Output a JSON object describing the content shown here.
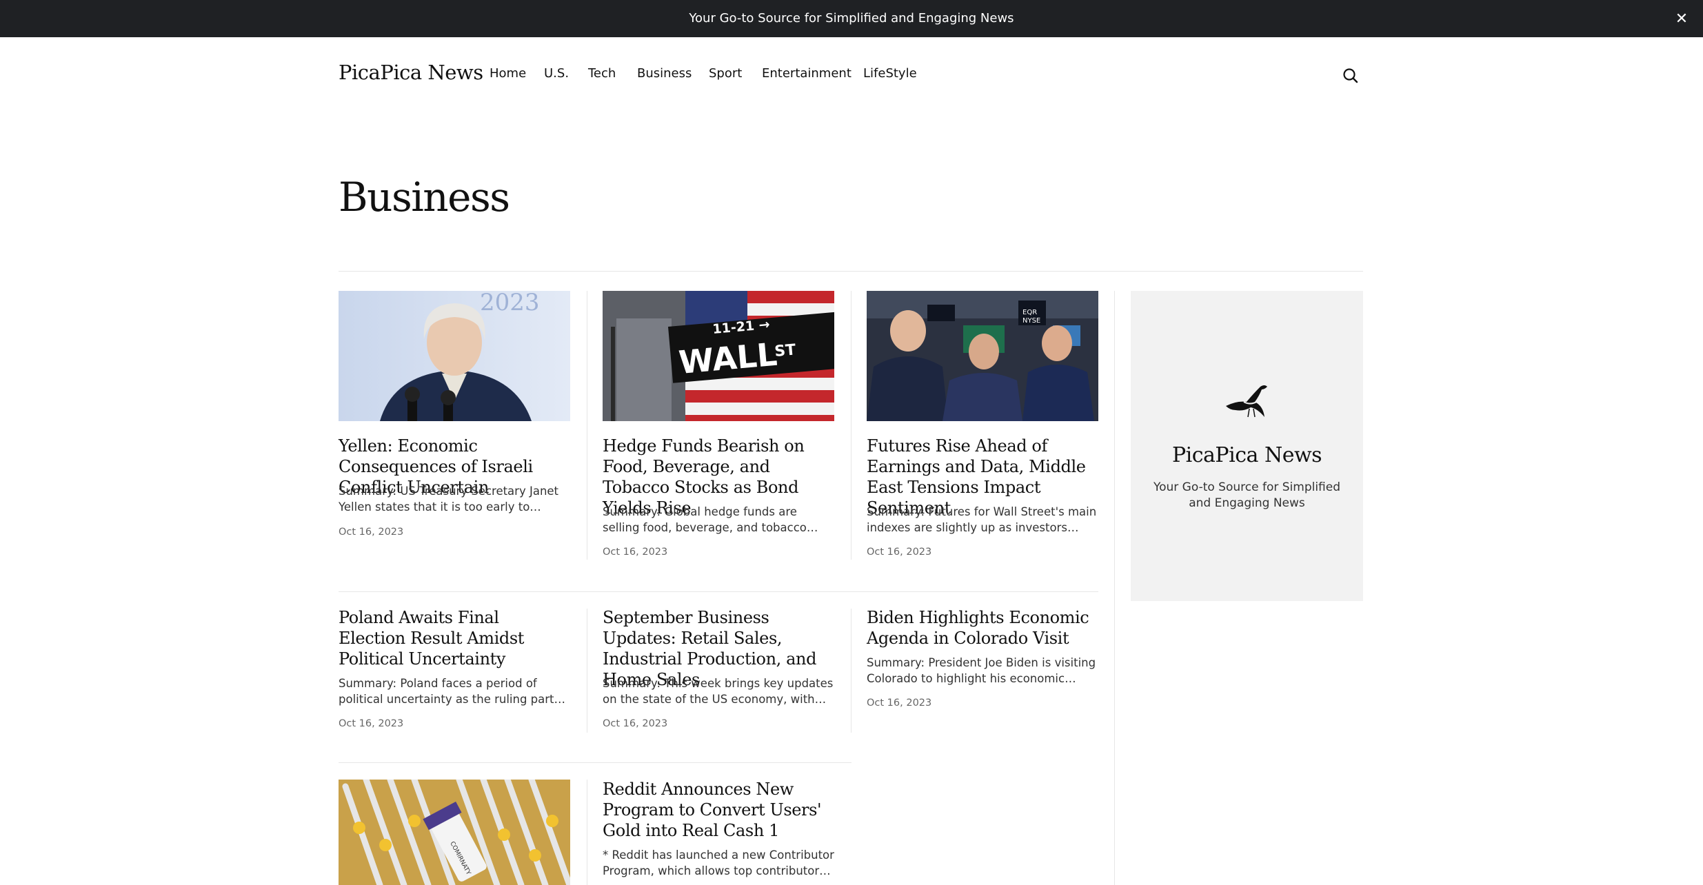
{
  "banner": {
    "text": "Your Go-to Source for Simplified and Engaging News",
    "close_icon": "close-icon"
  },
  "header": {
    "logo": "PicaPica News",
    "nav": [
      "Home",
      "U.S.",
      "Tech",
      "Business",
      "Sport",
      "Entertainment",
      "LifeStyle"
    ],
    "search_icon": "search-icon"
  },
  "page": {
    "title": "Business"
  },
  "articles": [
    {
      "title": "Yellen: Economic Consequences of Israeli Conflict Uncertain",
      "summary": "Summary: US Treasury Secretary Janet Yellen states that it is too early to predict the economic consequences of the Israeli conflict.",
      "date": "Oct 16, 2023",
      "image": "photo-yellen-speaking"
    },
    {
      "title": "Hedge Funds Bearish on Food, Beverage, and Tobacco Stocks as Bond Yields Rise",
      "summary": "Summary: Global hedge funds are selling food, beverage, and tobacco company shares as bond yields rise.",
      "date": "Oct 16, 2023",
      "image": "photo-wall-street-sign"
    },
    {
      "title": "Futures Rise Ahead of Earnings and Data, Middle East Tensions Impact Sentiment",
      "summary": "Summary: Futures for Wall Street's main indexes are slightly up as investors await earnings and data.",
      "date": "Oct 16, 2023",
      "image": "photo-nyse-traders"
    },
    {
      "title": "Poland Awaits Final Election Result Amidst Political Uncertainty",
      "summary": "Summary: Poland faces a period of political uncertainty as the ruling party and opposition await final results.",
      "date": "Oct 16, 2023"
    },
    {
      "title": "September Business Updates: Retail Sales, Industrial Production, and Home Sales",
      "summary": "Summary: This week brings key updates on the state of the US economy, with the release of several reports.",
      "date": "Oct 16, 2023"
    },
    {
      "title": "Biden Highlights Economic Agenda in Colorado Visit",
      "summary": "Summary: President Joe Biden is visiting Colorado to highlight his economic agenda and investments.",
      "date": "Oct 16, 2023"
    },
    {
      "title": "Reddit Announces New Program to Convert Users' Gold into Real Cash 1",
      "summary": "* Reddit has launched a new Contributor Program, which allows top contributors to earn real money.",
      "date": ""
    }
  ],
  "bottom_image": "photo-vaccine-vials",
  "sidebar": {
    "name": "PicaPica News",
    "tagline": "Your Go-to Source for Simplified and Engaging News",
    "logo_icon": "magpie-bird-icon"
  }
}
